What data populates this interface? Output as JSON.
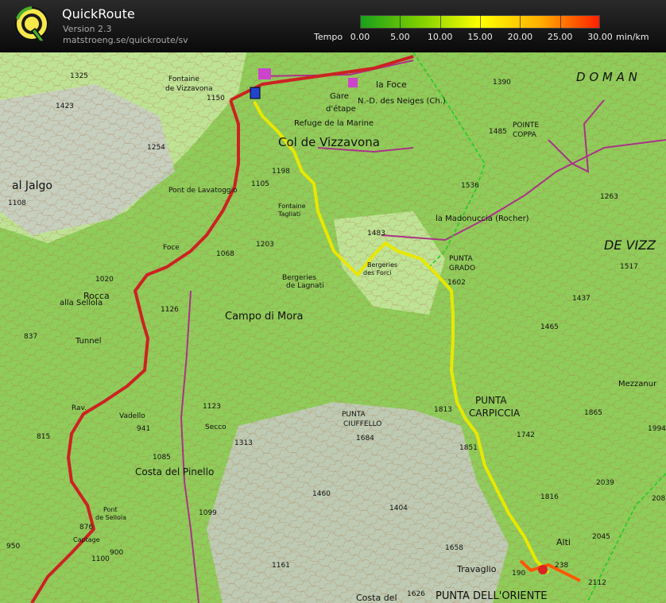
{
  "header": {
    "title": "QuickRoute",
    "version": "Version 2.3",
    "url": "matstroeng.se/quickroute/sv"
  },
  "legend": {
    "label": "Tempo",
    "unit": "min/km",
    "ticks": [
      "0.00",
      "5.00",
      "10.00",
      "15.00",
      "20.00",
      "25.00",
      "30.00"
    ],
    "gradient": [
      "#1aa01a",
      "#7fd000",
      "#ffff00",
      "#ffb000",
      "#ff2000"
    ]
  },
  "map": {
    "colors": {
      "forest": "#8fcc5a",
      "open": "#c8e6a0",
      "rock": "#c9c9c9",
      "road": "#cc2222",
      "route": "#e8e800",
      "boundary": "#22cc22",
      "trail": "#aa3388"
    },
    "labels": {
      "domain": "D O M A N",
      "de_vizz": "DE VIZZ",
      "la_foce": "la Foce",
      "nd_neiges": "N.-D. des Neiges (Ch.)",
      "gare": "Gare",
      "etape": "d'étape",
      "refuge": "Refuge de la Marine",
      "col": "Col de Vizzavona",
      "fontaine_vizz": "Fontaine",
      "fontaine_vizz2": "de Vizzavona",
      "pont_lav": "Pont de Lavatoggio",
      "fontaine_tag": "Fontaine",
      "fontaine_tag2": "Tagliati",
      "madonuccia": "la Madonuccia (Rocher)",
      "punta_grado": "PUNTA",
      "punta_grado2": "GRADO",
      "pointe_coppa": "POINTE",
      "pointe_coppa2": "COPPA",
      "bergeries": "Bergeries",
      "bergeries2": "de Lagnati",
      "bergeries_forci": "Bergeries",
      "bergeries_forci2": "des Forci",
      "campo": "Campo di Mora",
      "rocca": "Rocca",
      "rocca2": "alla Sellola",
      "tunnel": "Tunnel",
      "al_jalgo": "al Jalgo",
      "punta_carp": "PUNTA",
      "punta_carp2": "CARPICCIA",
      "punta_ciuff": "PUNTA",
      "punta_ciuff2": "CIUFFELLO",
      "costa_pinello": "Costa del Pinello",
      "pont_sellola": "Pont",
      "pont_sellola2": "de Sellola",
      "captage": "Captage",
      "travaglio": "Travaglio",
      "costa": "Costa del",
      "punta_oriente": "PUNTA DELL'ORIENTE",
      "mezzanur": "Mezzanur",
      "foce": "Foce",
      "vadello": "Vadello",
      "secco": "Secco",
      "alti": "Alti",
      "rav": "Rav."
    },
    "spot_heights": [
      "1325",
      "1423",
      "1254",
      "1150",
      "1108",
      "1105",
      "1198",
      "1068",
      "1203",
      "1020",
      "837",
      "1126",
      "1390",
      "1485",
      "1536",
      "1263",
      "1483",
      "1602",
      "1517",
      "1437",
      "1465",
      "1813",
      "1851",
      "1742",
      "1865",
      "1684",
      "1994",
      "1123",
      "1313",
      "941",
      "815",
      "1085",
      "1099",
      "1460",
      "1404",
      "1658",
      "1816",
      "2039",
      "2045",
      "2112",
      "1626",
      "876",
      "950",
      "900",
      "1161",
      "190",
      "238",
      "208",
      "1100"
    ]
  }
}
